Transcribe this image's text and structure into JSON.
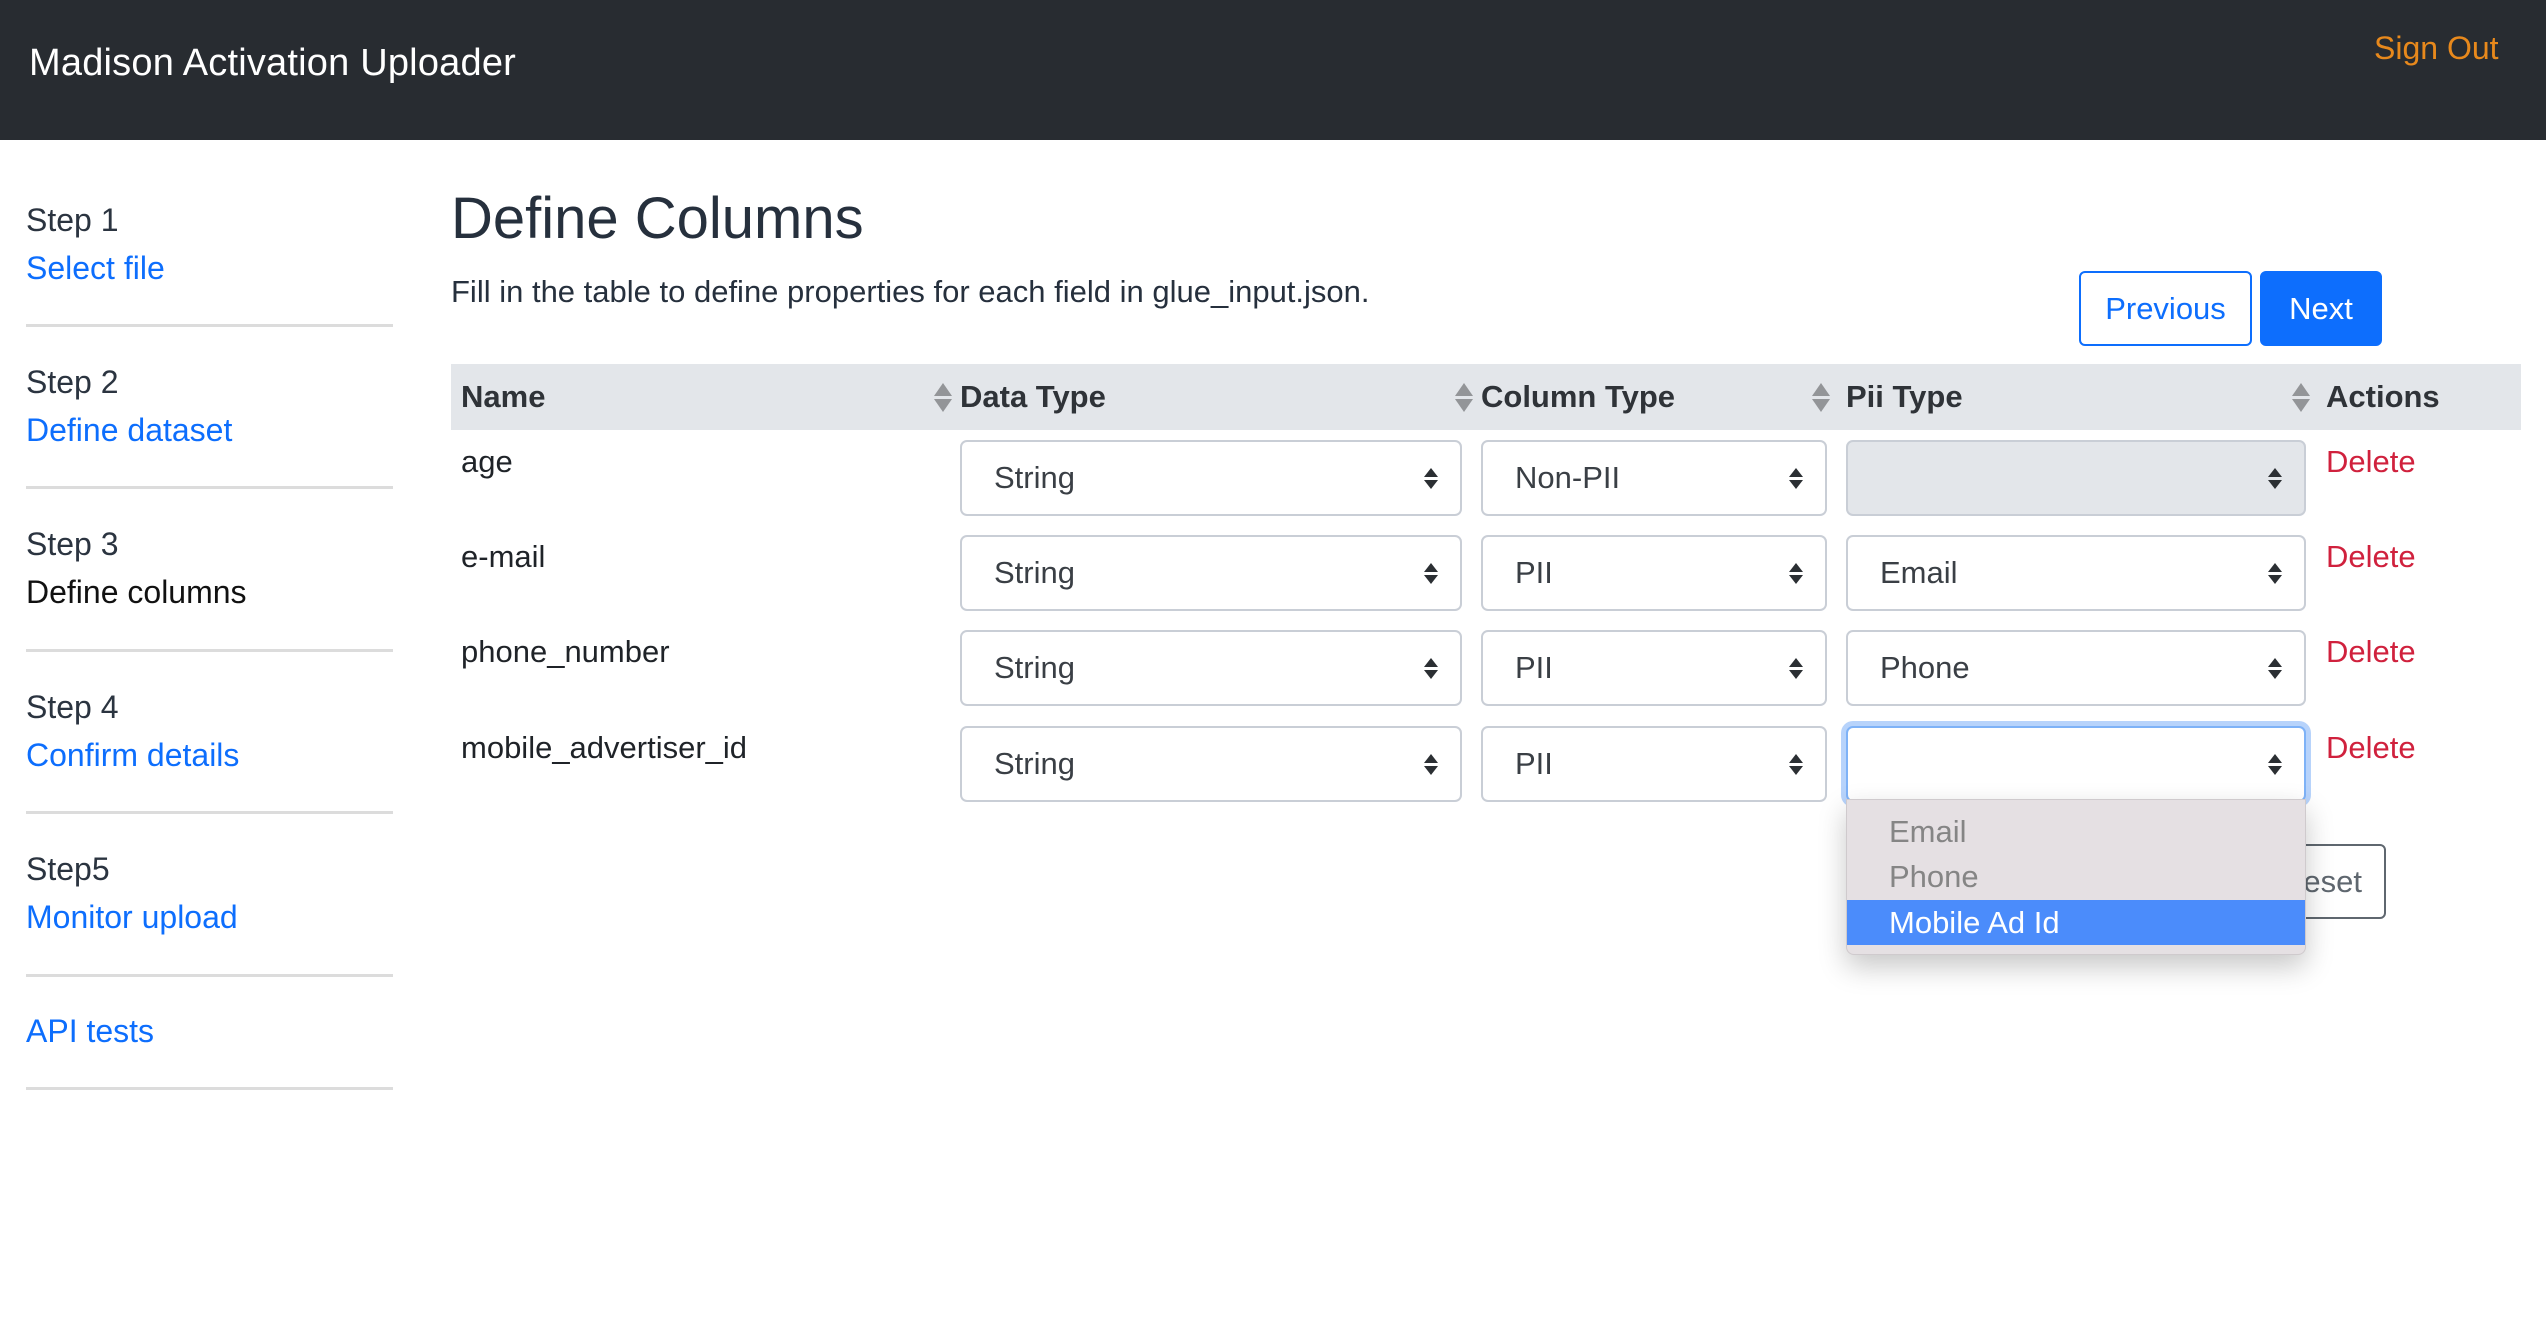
{
  "navbar": {
    "title": "Madison Activation Uploader",
    "sign_out": "Sign Out",
    "sign_out_color": "#e8891c"
  },
  "sidebar": {
    "items": [
      {
        "step": "Step 1",
        "label": "Select file",
        "current": false
      },
      {
        "step": "Step 2",
        "label": "Define dataset",
        "current": false
      },
      {
        "step": "Step 3",
        "label": "Define columns",
        "current": true
      },
      {
        "step": "Step 4",
        "label": "Confirm details",
        "current": false
      },
      {
        "step": "Step5",
        "label": "Monitor upload",
        "current": false
      },
      {
        "step": "",
        "label": "API tests",
        "current": false
      }
    ]
  },
  "main": {
    "title": "Define Columns",
    "subtitle": "Fill in the table to define properties for each field in glue_input.json.",
    "buttons": {
      "previous": "Previous",
      "next": "Next",
      "reset": "Reset"
    },
    "table": {
      "columns": [
        "Name",
        "Data Type",
        "Column Type",
        "Pii Type",
        "Actions"
      ],
      "rows": [
        {
          "name": "age",
          "data_type": "String",
          "column_type": "Non-PII",
          "pii_type": "",
          "pii_disabled": true,
          "action": "Delete"
        },
        {
          "name": "e-mail",
          "data_type": "String",
          "column_type": "PII",
          "pii_type": "Email",
          "pii_disabled": false,
          "action": "Delete"
        },
        {
          "name": "phone_number",
          "data_type": "String",
          "column_type": "PII",
          "pii_type": "Phone",
          "pii_disabled": false,
          "action": "Delete"
        },
        {
          "name": "mobile_advertiser_id",
          "data_type": "String",
          "column_type": "PII",
          "pii_type": "",
          "pii_disabled": false,
          "action": "Delete"
        }
      ]
    },
    "dropdown": {
      "options": [
        "Email",
        "Phone",
        "Mobile Ad Id"
      ],
      "highlighted": "Mobile Ad Id"
    }
  },
  "colors": {
    "primary": "#0d6efd",
    "danger": "#d0213d",
    "navbar_bg": "#282c31",
    "table_header_bg": "#e3e6ea",
    "dropdown_highlight": "#4b8cfb"
  }
}
